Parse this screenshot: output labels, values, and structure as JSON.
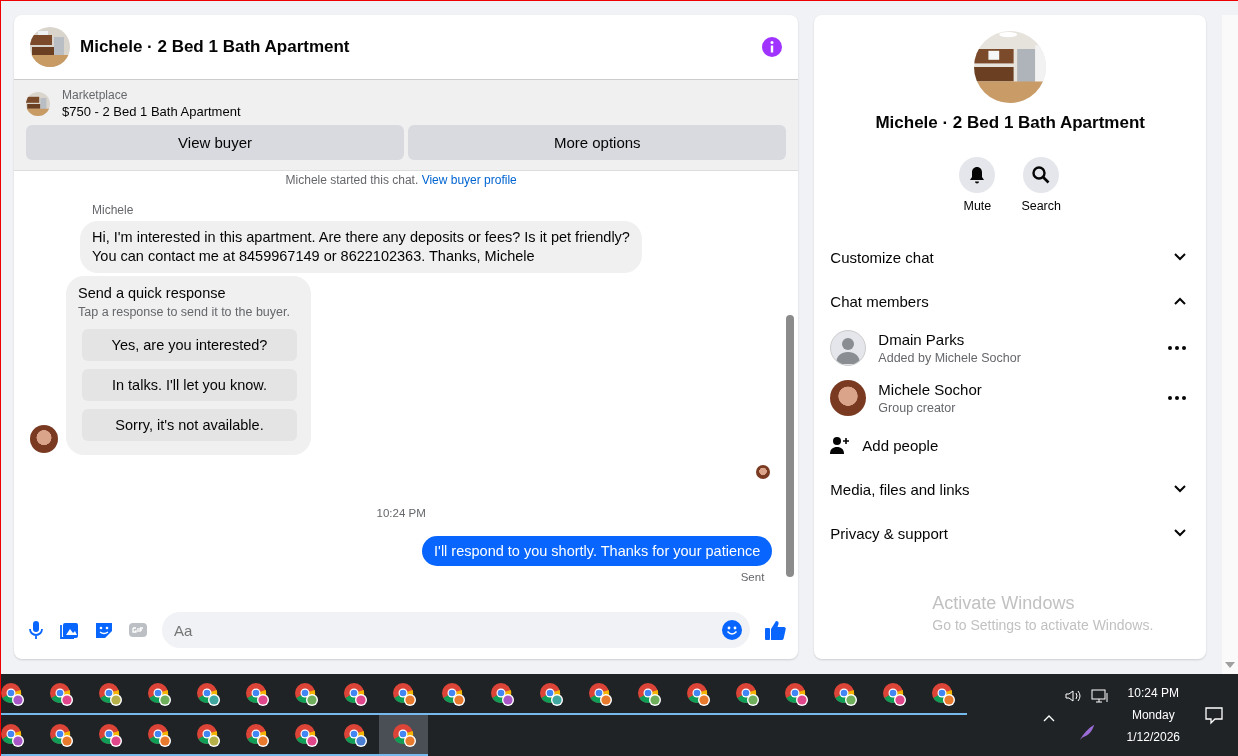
{
  "chat": {
    "title": "Michele · 2 Bed 1 Bath Apartment",
    "listing": {
      "source": "Marketplace",
      "title": "$750 - 2 Bed 1 Bath Apartment"
    },
    "actions": [
      "View buyer",
      "More options"
    ],
    "notice": {
      "text": "Michele started this chat.",
      "link": "View buyer profile"
    },
    "sender": "Michele",
    "incoming": "Hi, I'm interested in this apartment. Are there any deposits or fees? Is it pet friendly?\nYou can contact me at 8459967149 or 8622102363. Thanks, Michele",
    "quick_response": {
      "title": "Send a quick response",
      "hint": "Tap a response to send it to the buyer.",
      "options": [
        "Yes, are you interested?",
        "In talks. I'll let you know.",
        "Sorry, it's not available."
      ]
    },
    "time": "10:24 PM",
    "outgoing": "I'll respond to you shortly. Thanks for your patience",
    "status": "Sent",
    "composer": {
      "placeholder": "Aa"
    }
  },
  "details": {
    "title": "Michele · 2 Bed 1 Bath Apartment",
    "actions": [
      {
        "label": "Mute",
        "kind": "bell"
      },
      {
        "label": "Search",
        "kind": "search"
      }
    ],
    "sections": [
      {
        "label": "Customize chat",
        "expanded": false
      },
      {
        "label": "Chat members",
        "expanded": true,
        "members": [
          {
            "name": "Dmain Parks",
            "role": "Added by Michele Sochor",
            "kind": "default"
          },
          {
            "name": "Michele Sochor",
            "role": "Group creator"
          }
        ],
        "add": "Add people"
      },
      {
        "label": "Media, files and links",
        "expanded": false
      },
      {
        "label": "Privacy & support",
        "expanded": false
      }
    ]
  },
  "activation": {
    "title": "Activate Windows",
    "hint": "Go to Settings to activate Windows."
  },
  "taskbar": {
    "rows": [
      [
        {
          "color": "#a855c8",
          "selected": false
        },
        {
          "color": "#e0468c",
          "selected": false
        },
        {
          "color": "#b5b04a",
          "selected": false
        },
        {
          "color": "#6fae5a",
          "selected": false
        },
        {
          "color": "#3fa7a0",
          "selected": false
        },
        {
          "color": "#e0468c",
          "selected": false
        },
        {
          "color": "#6fae5a",
          "selected": false
        },
        {
          "color": "#e0468c",
          "selected": false
        },
        {
          "color": "#e87a2e",
          "selected": false
        },
        {
          "color": "#e87a2e",
          "selected": false
        },
        {
          "color": "#a855c8",
          "selected": false
        },
        {
          "color": "#3fa7a0",
          "selected": false
        },
        {
          "color": "#e87a2e",
          "selected": false
        },
        {
          "color": "#6fae5a",
          "selected": false
        },
        {
          "color": "#e87a2e",
          "selected": false
        },
        {
          "color": "#6fae5a",
          "selected": false
        },
        {
          "color": "#e0468c",
          "selected": false
        },
        {
          "color": "#6fae5a",
          "selected": false
        },
        {
          "color": "#e0468c",
          "selected": false
        },
        {
          "color": "#e87a2e",
          "selected": false
        }
      ],
      [
        {
          "color": "#a855c8",
          "selected": false
        },
        {
          "color": "#e87a2e",
          "selected": false
        },
        {
          "color": "#e0468c",
          "selected": false
        },
        {
          "color": "#e87a2e",
          "selected": false
        },
        {
          "color": "#b5b04a",
          "selected": false
        },
        {
          "color": "#e87a2e",
          "selected": false
        },
        {
          "color": "#e0468c",
          "selected": false
        },
        {
          "color": "#4a7fd4",
          "selected": false
        },
        {
          "color": "#e87a2e",
          "selected": true
        }
      ]
    ],
    "time": "10:24 PM",
    "day": "Monday",
    "date": "1/12/2026"
  }
}
